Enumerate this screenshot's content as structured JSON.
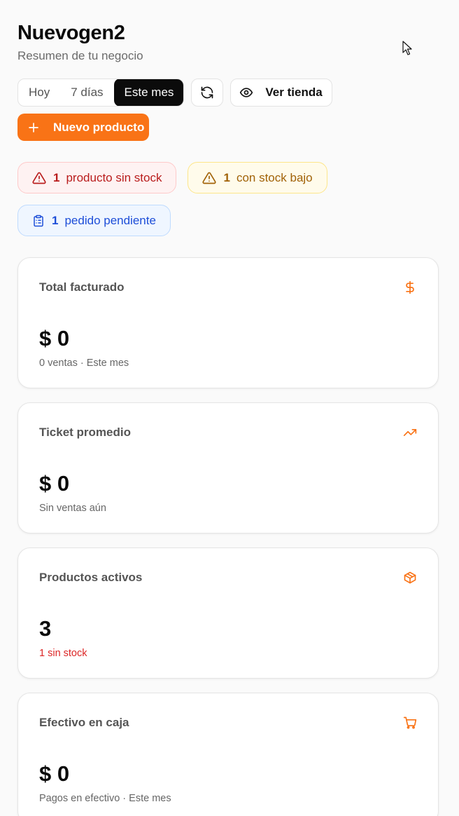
{
  "header": {
    "title": "Nuevogen2",
    "subtitle": "Resumen de tu negocio"
  },
  "range_tabs": [
    {
      "label": "Hoy",
      "active": false
    },
    {
      "label": "7 días",
      "active": false
    },
    {
      "label": "Este mes",
      "active": true
    }
  ],
  "toolbar": {
    "refresh_icon": "refresh-icon",
    "view_store_label": "Ver tienda",
    "new_product_label": "Nuevo producto"
  },
  "alerts": {
    "out_of_stock": {
      "count": "1",
      "text": "producto sin stock"
    },
    "low_stock": {
      "count": "1",
      "text": "con stock bajo"
    },
    "pending_orders": {
      "count": "1",
      "text": "pedido pendiente"
    }
  },
  "cards": {
    "total": {
      "label": "Total facturado",
      "value": "$ 0",
      "sub": "0 ventas · Este mes",
      "icon": "dollar-icon"
    },
    "ticket": {
      "label": "Ticket promedio",
      "value": "$ 0",
      "sub": "Sin ventas aún",
      "icon": "trending-up-icon"
    },
    "products": {
      "label": "Productos activos",
      "value": "3",
      "sub": "1 sin stock",
      "icon": "package-icon"
    },
    "cash": {
      "label": "Efectivo en caja",
      "value": "$ 0",
      "sub": "Pagos en efectivo · Este mes",
      "icon": "cart-icon"
    }
  },
  "colors": {
    "accent": "#f97316",
    "danger": "#dc2626",
    "warning": "#a16207",
    "info": "#1d4ed8"
  }
}
